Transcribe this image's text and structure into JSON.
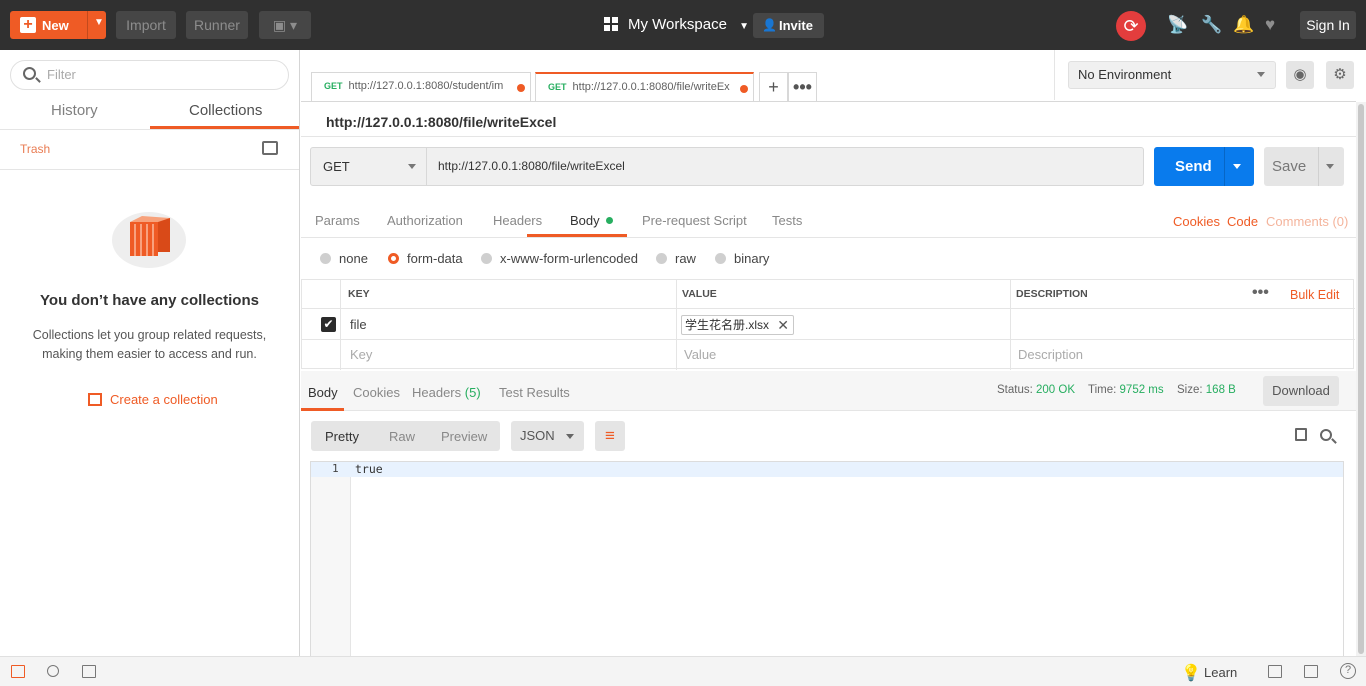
{
  "topbar": {
    "new_label": "New",
    "import_label": "Import",
    "runner_label": "Runner",
    "workspace_label": "My Workspace",
    "invite_label": "Invite",
    "signin_label": "Sign In"
  },
  "sidebar": {
    "filter_placeholder": "Filter",
    "tabs": [
      {
        "label": "History"
      },
      {
        "label": "Collections"
      }
    ],
    "trash_label": "Trash",
    "empty_title": "You don’t have any collections",
    "empty_desc": "Collections let you group related requests, making them easier to access and run.",
    "create_label": "Create a collection"
  },
  "request_tabs": [
    {
      "method": "GET",
      "url": "http://127.0.0.1:8080/student/im"
    },
    {
      "method": "GET",
      "url": "http://127.0.0.1:8080/file/writeEx"
    }
  ],
  "environment": {
    "selected": "No Environment"
  },
  "request": {
    "title": "http://127.0.0.1:8080/file/writeExcel",
    "method": "GET",
    "url": "http://127.0.0.1:8080/file/writeExcel",
    "send_label": "Send",
    "save_label": "Save",
    "tabs": [
      "Params",
      "Authorization",
      "Headers",
      "Body",
      "Pre-request Script",
      "Tests"
    ],
    "links": {
      "cookies": "Cookies",
      "code": "Code",
      "comments": "Comments (0)"
    },
    "body_modes": [
      "none",
      "form-data",
      "x-www-form-urlencoded",
      "raw",
      "binary"
    ],
    "body_mode_selected": "form-data",
    "table": {
      "headers": {
        "key": "KEY",
        "value": "VALUE",
        "description": "DESCRIPTION"
      },
      "bulk_edit": "Bulk Edit",
      "rows": [
        {
          "key": "file",
          "value": "学生花名册.xlsx",
          "checked": true
        }
      ],
      "placeholders": {
        "key": "Key",
        "value": "Value",
        "description": "Description"
      }
    }
  },
  "response": {
    "tabs": {
      "body": "Body",
      "cookies": "Cookies",
      "headers": "Headers",
      "headers_count": "(5)",
      "tests": "Test Results"
    },
    "status_label": "Status:",
    "status_value": "200 OK",
    "time_label": "Time:",
    "time_value": "9752 ms",
    "size_label": "Size:",
    "size_value": "168 B",
    "download_label": "Download",
    "formats": [
      "Pretty",
      "Raw",
      "Preview"
    ],
    "lang": "JSON",
    "line_number": "1",
    "content": "true"
  },
  "footer": {
    "learn_label": "Learn"
  },
  "colors": {
    "accent": "#ef5b25",
    "send": "#097bed",
    "topbar": "#303030",
    "ok": "#27ae60"
  }
}
